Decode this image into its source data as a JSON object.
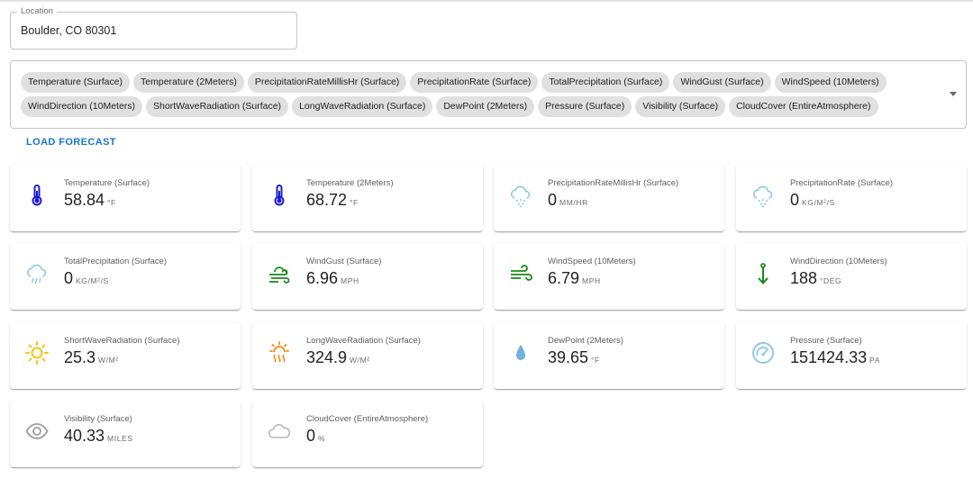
{
  "location": {
    "label": "Location",
    "value": "Boulder, CO 80301"
  },
  "variables": [
    "Temperature (Surface)",
    "Temperature (2Meters)",
    "PrecipitationRateMillisHr (Surface)",
    "PrecipitationRate (Surface)",
    "TotalPrecipitation (Surface)",
    "WindGust (Surface)",
    "WindSpeed (10Meters)",
    "WindDirection (10Meters)",
    "ShortWaveRadiation (Surface)",
    "LongWaveRadiation (Surface)",
    "DewPoint (2Meters)",
    "Pressure (Surface)",
    "Visibility (Surface)",
    "CloudCover (EntireAtmosphere)"
  ],
  "load_button": "LOAD FORECAST",
  "colors": {
    "accent": "#1976d2",
    "temp": "#1a1ad6",
    "precip": "#8fc8e8",
    "wind": "#1a8a1a",
    "sun": "#f5c518",
    "sun_longwave": "#f08a1c",
    "dew": "#6fb0dc",
    "pressure": "#8fc8e8",
    "muted": "#9e9e9e"
  },
  "cards": [
    {
      "label": "Temperature (Surface)",
      "value": "58.84",
      "unit": "°F",
      "icon": "thermometer-icon"
    },
    {
      "label": "Temperature (2Meters)",
      "value": "68.72",
      "unit": "°F",
      "icon": "thermometer-icon"
    },
    {
      "label": "PrecipitationRateMillisHr (Surface)",
      "value": "0",
      "unit": "MM/HR",
      "icon": "snow-cloud-icon"
    },
    {
      "label": "PrecipitationRate (Surface)",
      "value": "0",
      "unit": "KG/M²/S",
      "icon": "snow-cloud-icon"
    },
    {
      "label": "TotalPrecipitation (Surface)",
      "value": "0",
      "unit": "KG/M²/S",
      "icon": "rain-cloud-icon"
    },
    {
      "label": "WindGust (Surface)",
      "value": "6.96",
      "unit": "MPH",
      "icon": "wind-cloud-icon"
    },
    {
      "label": "WindSpeed (10Meters)",
      "value": "6.79",
      "unit": "MPH",
      "icon": "wind-icon"
    },
    {
      "label": "WindDirection (10Meters)",
      "value": "188",
      "unit": "°DEG",
      "icon": "direction-arrow-icon"
    },
    {
      "label": "ShortWaveRadiation (Surface)",
      "value": "25.3",
      "unit": "W/M²",
      "icon": "sun-icon"
    },
    {
      "label": "LongWaveRadiation (Surface)",
      "value": "324.9",
      "unit": "W/M²",
      "icon": "sun-heat-icon"
    },
    {
      "label": "DewPoint (2Meters)",
      "value": "39.65",
      "unit": "°F",
      "icon": "droplet-icon"
    },
    {
      "label": "Pressure (Surface)",
      "value": "151424.33",
      "unit": "PA",
      "icon": "gauge-icon"
    },
    {
      "label": "Visibility (Surface)",
      "value": "40.33",
      "unit": "MILES",
      "icon": "eye-icon"
    },
    {
      "label": "CloudCover (EntireAtmosphere)",
      "value": "0",
      "unit": "%",
      "icon": "cloud-icon"
    }
  ]
}
